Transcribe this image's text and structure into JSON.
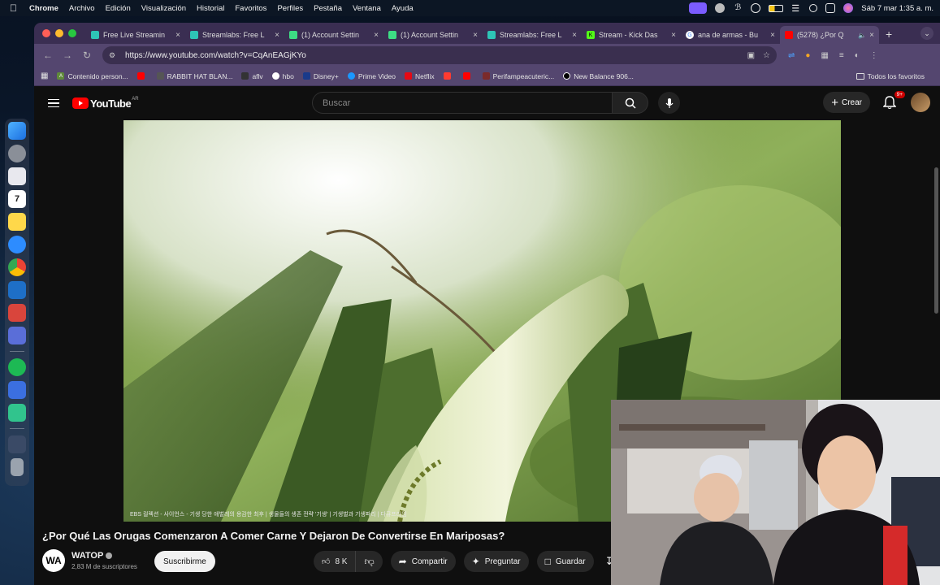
{
  "menubar": {
    "app": "Chrome",
    "items": [
      "Archivo",
      "Edición",
      "Visualización",
      "Historial",
      "Favoritos",
      "Perfiles",
      "Pestaña",
      "Ventana",
      "Ayuda"
    ],
    "clock": "Sáb 7 mar  1:35 a. m."
  },
  "tabs": [
    {
      "label": "Free Live Streamin",
      "color": "#2ec4b6",
      "active": false
    },
    {
      "label": "Streamlabs: Free L",
      "color": "#2ec4b6",
      "active": false
    },
    {
      "label": "(1) Account Settin",
      "color": "#3ddc84",
      "active": false
    },
    {
      "label": "(1) Account Settin",
      "color": "#3ddc84",
      "active": false
    },
    {
      "label": "Streamlabs: Free L",
      "color": "#2ec4b6",
      "active": false
    },
    {
      "label": "Stream - Kick Das",
      "color": "#53fc18",
      "active": false
    },
    {
      "label": "ana de armas - Bu",
      "color": "#4285f4",
      "active": false
    },
    {
      "label": "(5278) ¿Por Q",
      "color": "#ff0000",
      "active": true
    }
  ],
  "address": {
    "url": "https://www.youtube.com/watch?v=CqAnEAGjKYo"
  },
  "bookmarks": [
    {
      "label": "Contenido person...",
      "color": "#5f8a3a"
    },
    {
      "label": "",
      "color": "#ff0000"
    },
    {
      "label": "RABBIT HAT BLAN...",
      "color": "#555555"
    },
    {
      "label": "aflv",
      "color": "#333333"
    },
    {
      "label": "hbo",
      "color": "#ffffff"
    },
    {
      "label": "Disney+",
      "color": "#1a3a8a"
    },
    {
      "label": "Prime Video",
      "color": "#1a98ff"
    },
    {
      "label": "Netflix",
      "color": "#e50914"
    },
    {
      "label": "",
      "color": "#ff3b30"
    },
    {
      "label": "",
      "color": "#ff0000"
    },
    {
      "label": "Perifampeacuteric...",
      "color": "#7a2a2a"
    },
    {
      "label": "New Balance 906...",
      "color": "#000000"
    }
  ],
  "bookmarks_all": "Todos los favoritos",
  "youtube": {
    "logo_text": "YouTube",
    "country": "AR",
    "search_placeholder": "Buscar",
    "create_label": "Crear",
    "notif_badge": "9+",
    "video_caption": "EBS 컬렉션 - 사이언스 - 기생 당한 애벌레의 용감한 최후 | 생물들의 생존 전략 '기생' | 기생벌과 기생파리 | 다큐프라임",
    "title": "¿Por Qué Las Orugas Comenzaron A Comer Carne Y Dejaron De Convertirse En Mariposas?",
    "channel_name": "WATOP",
    "channel_initials": "WA",
    "subscribers": "2,83 M de suscriptores",
    "subscribe_label": "Suscribirme",
    "likes": "8 K",
    "share_label": "Compartir",
    "ask_label": "Preguntar",
    "save_label": "Guardar"
  }
}
